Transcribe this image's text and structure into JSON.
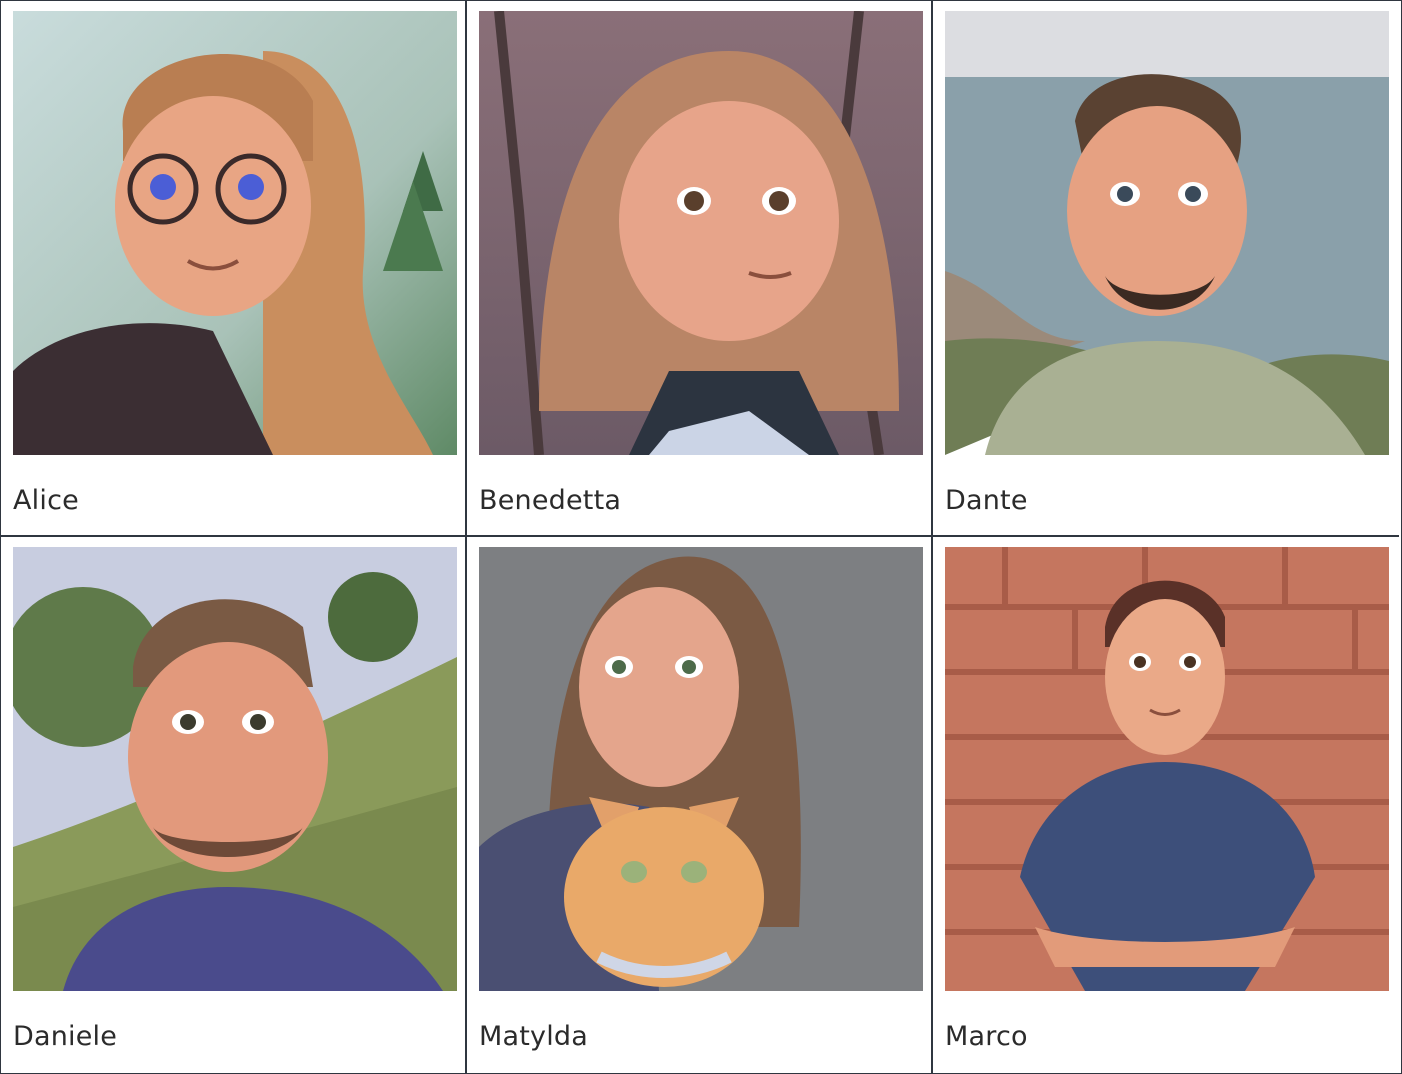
{
  "gallery": {
    "people": [
      {
        "name": "Alice",
        "icon": "cartoon-portrait-woman-glasses"
      },
      {
        "name": "Benedetta",
        "icon": "cartoon-portrait-woman-wavy-hair"
      },
      {
        "name": "Dante",
        "icon": "cartoon-portrait-man-seaside"
      },
      {
        "name": "Daniele",
        "icon": "cartoon-portrait-man-hillside"
      },
      {
        "name": "Matylda",
        "icon": "cartoon-portrait-woman-with-cat"
      },
      {
        "name": "Marco",
        "icon": "cartoon-portrait-man-brick-wall"
      }
    ]
  },
  "colors": {
    "border": "#2f3640",
    "text": "#2b2b2b"
  }
}
